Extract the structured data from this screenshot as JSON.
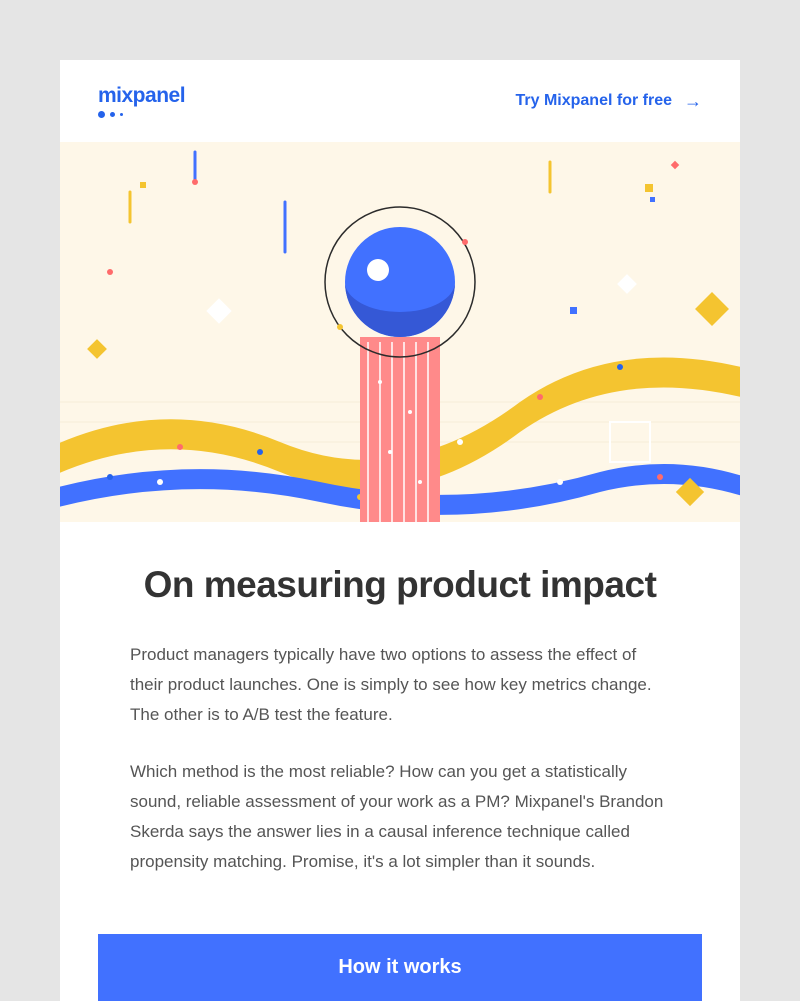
{
  "header": {
    "logo_text": "mixpanel",
    "cta_label": "Try Mixpanel for free"
  },
  "article": {
    "title": "On measuring product impact",
    "paragraph1": "Product managers typically have two options to assess the effect of their product launches. One is simply to see how key metrics change. The other is to A/B test the feature.",
    "paragraph2": "Which method is the most reliable? How can you get a statistically sound, reliable assessment of your work as a PM? Mixpanel's Brandon Skerda says the answer lies in a causal inference technique called propensity matching. Promise, it's a lot simpler than it sounds."
  },
  "cta": {
    "button_label": "How it works"
  }
}
